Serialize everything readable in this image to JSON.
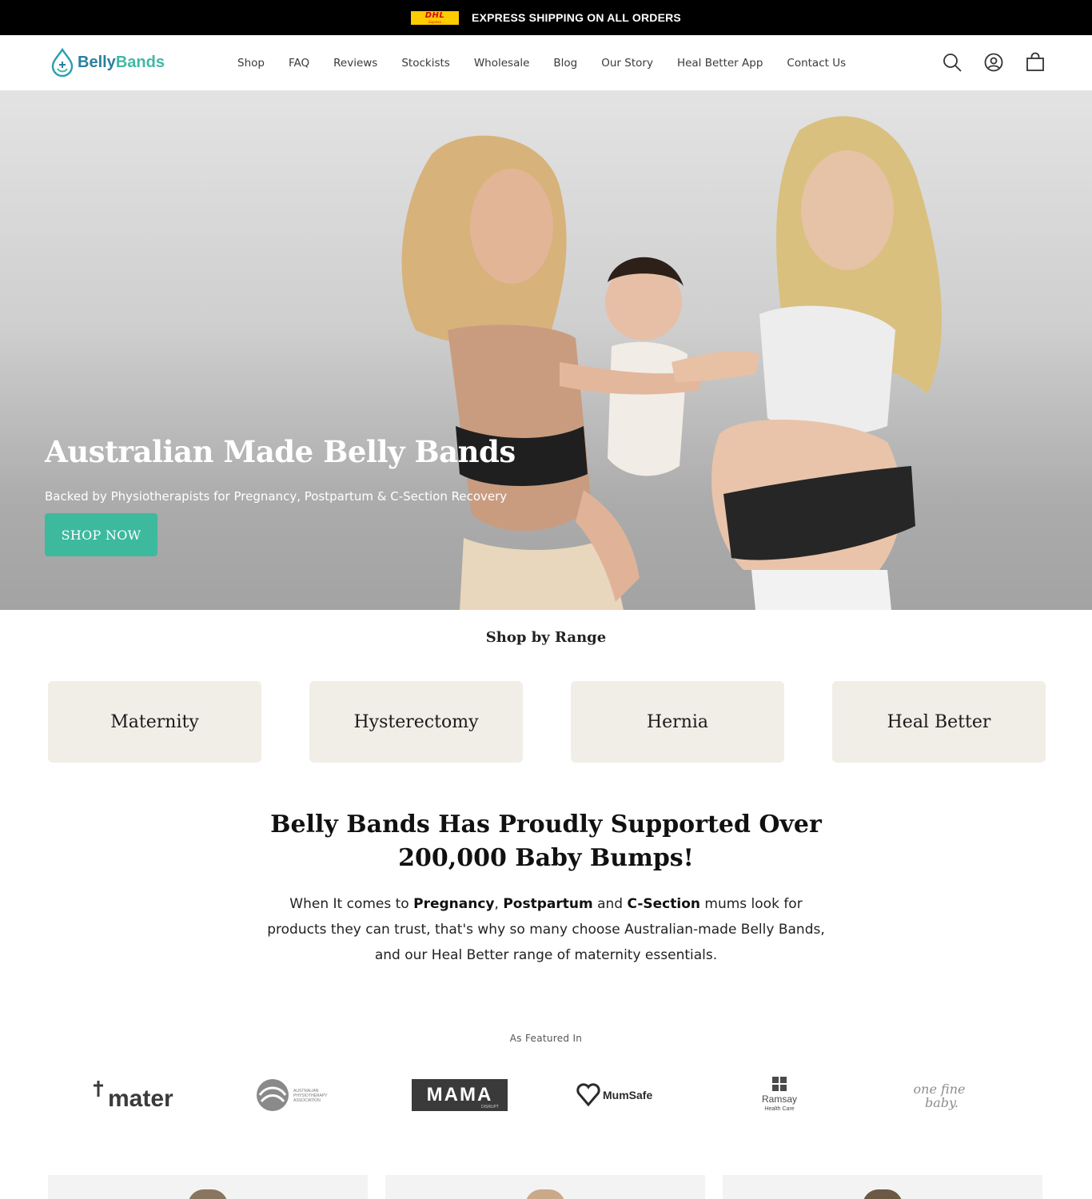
{
  "announcement": {
    "carrier_logo_text": "DHL",
    "carrier_logo_subtext": "Express",
    "text": "EXPRESS SHIPPING ON ALL ORDERS"
  },
  "header": {
    "logo": {
      "part1": "Belly",
      "part2": "Bands"
    },
    "nav": [
      "Shop",
      "FAQ",
      "Reviews",
      "Stockists",
      "Wholesale",
      "Blog",
      "Our Story",
      "Heal Better App",
      "Contact Us"
    ],
    "icons": [
      "search-icon",
      "account-icon",
      "cart-icon"
    ]
  },
  "hero": {
    "title": "Australian Made Belly Bands",
    "subtitle": "Backed by Physiotherapists for Pregnancy, Postpartum & C-Section Recovery",
    "cta": "SHOP NOW",
    "accent": "#3db99e"
  },
  "range": {
    "title": "Shop by Range",
    "items": [
      "Maternity",
      "Hysterectomy",
      "Hernia",
      "Heal Better"
    ]
  },
  "supported": {
    "line1": "Belly Bands Has Proudly Supported Over",
    "line2": "200,000 Baby Bumps!",
    "p_a": "When It comes to ",
    "p_b1": "Pregnancy",
    "p_c": ", ",
    "p_b2": "Postpartum",
    "p_d": " and ",
    "p_b3": "C-Section",
    "p_e": " mums look for products they can trust, that's why so many choose Australian-made Belly Bands, and our Heal Better range of maternity essentials."
  },
  "featured": {
    "title": "As Featured In",
    "logos": [
      {
        "name": "mater",
        "text": "mater"
      },
      {
        "name": "apa",
        "text": "AUSTRALIAN PHYSIOTHERAPY ASSOCIATION"
      },
      {
        "name": "mama",
        "text": "MAMA",
        "sub": "DISRUPT"
      },
      {
        "name": "mumsafe",
        "text": "MumSafe"
      },
      {
        "name": "ramsay",
        "text": "Ramsay",
        "sub": "Health Care"
      },
      {
        "name": "onefinebaby",
        "text": "one fine",
        "sub": "baby."
      }
    ]
  }
}
